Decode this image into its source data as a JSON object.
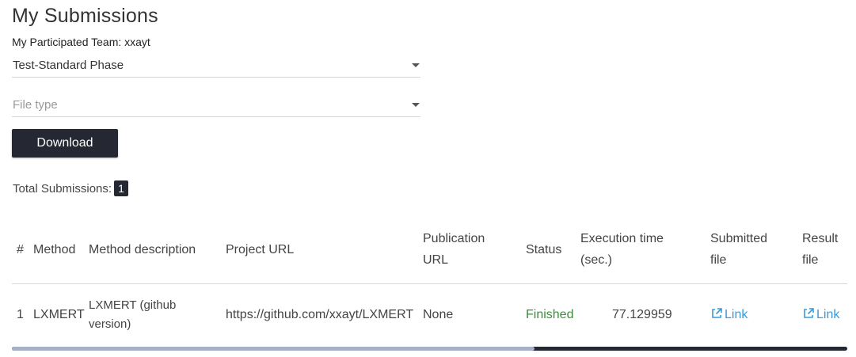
{
  "page": {
    "title": "My Submissions",
    "team_label": "My Participated Team: xxayt"
  },
  "filters": {
    "phase": "Test-Standard Phase",
    "file_type_placeholder": "File type"
  },
  "download_label": "Download",
  "total": {
    "label": "Total Submissions:",
    "count": "1"
  },
  "table": {
    "headers": {
      "index": "#",
      "method": "Method",
      "method_description": "Method description",
      "project_url": "Project URL",
      "publication_url_1": "Publication",
      "publication_url_2": "URL",
      "status": "Status",
      "execution_time_1": "Execution time",
      "execution_time_2": "(sec.)",
      "submitted_file_1": "Submitted",
      "submitted_file_2": "file",
      "result_file_1": "Result",
      "result_file_2": "file"
    },
    "rows": [
      {
        "index": "1",
        "method": "LXMERT",
        "method_description_1": "LXMERT (github",
        "method_description_2": "version)",
        "project_url": "https://github.com/xxayt/LXMERT",
        "publication_url": "None",
        "status": "Finished",
        "execution_time": "77.129959",
        "submitted_file": "Link",
        "result_file": "Link"
      }
    ]
  },
  "colors": {
    "dark_button": "#252833",
    "status_finished": "#3c8c3c",
    "link": "#3a9ad9"
  },
  "icons": {
    "filter_caret": "chevron-down-icon",
    "link_icon": "external-link-icon"
  }
}
